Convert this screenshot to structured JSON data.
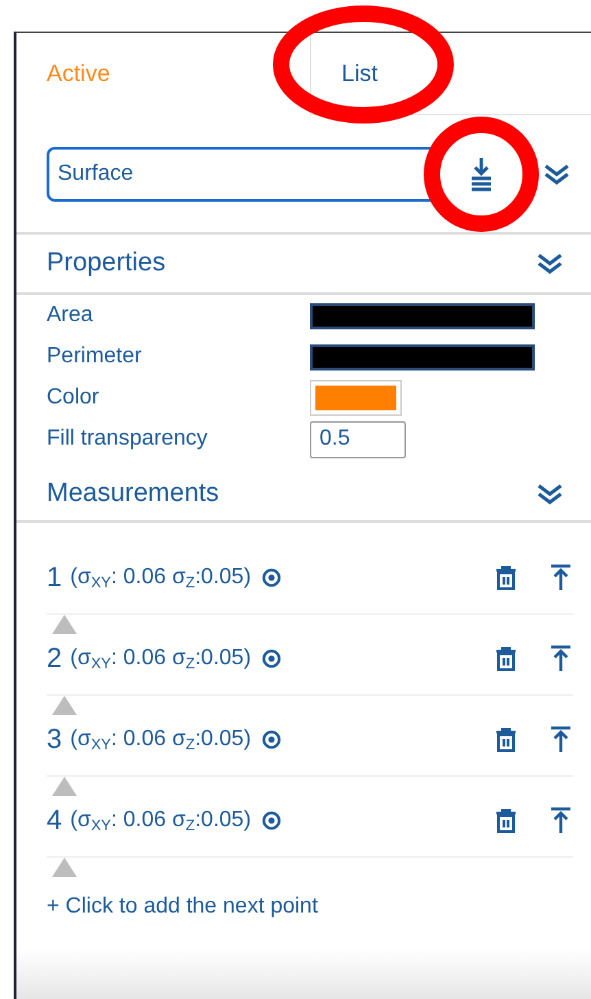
{
  "tabs": [
    {
      "label": "Active",
      "selected": true,
      "circled": false
    },
    {
      "label": "List",
      "selected": false,
      "circled": true
    }
  ],
  "toolbar": {
    "name_field": {
      "value": "Surface"
    },
    "download_circled": true
  },
  "properties": {
    "title": "Properties",
    "rows": [
      {
        "label": "Area",
        "kind": "redacted"
      },
      {
        "label": "Perimeter",
        "kind": "redacted"
      },
      {
        "label": "Color",
        "kind": "color",
        "color": "#ff7f00"
      },
      {
        "label": "Fill transparency",
        "kind": "number",
        "value": "0.5"
      }
    ]
  },
  "measurements": {
    "title": "Measurements",
    "points": [
      {
        "index": "1",
        "label": "(σ$_{XY}$: 0.06 σ$_{Z}$:0.05)"
      },
      {
        "index": "2",
        "label": "(σ$_{XY}$: 0.06 σ$_{Z}$:0.05)"
      },
      {
        "index": "3",
        "label": "(σ$_{XY}$: 0.06 σ$_{Z}$:0.05)"
      },
      {
        "index": "4",
        "label": "(σ$_{XY}$: 0.06 σ$_{Z}$:0.05)"
      }
    ],
    "add_link": "+ Click to add the next point"
  }
}
